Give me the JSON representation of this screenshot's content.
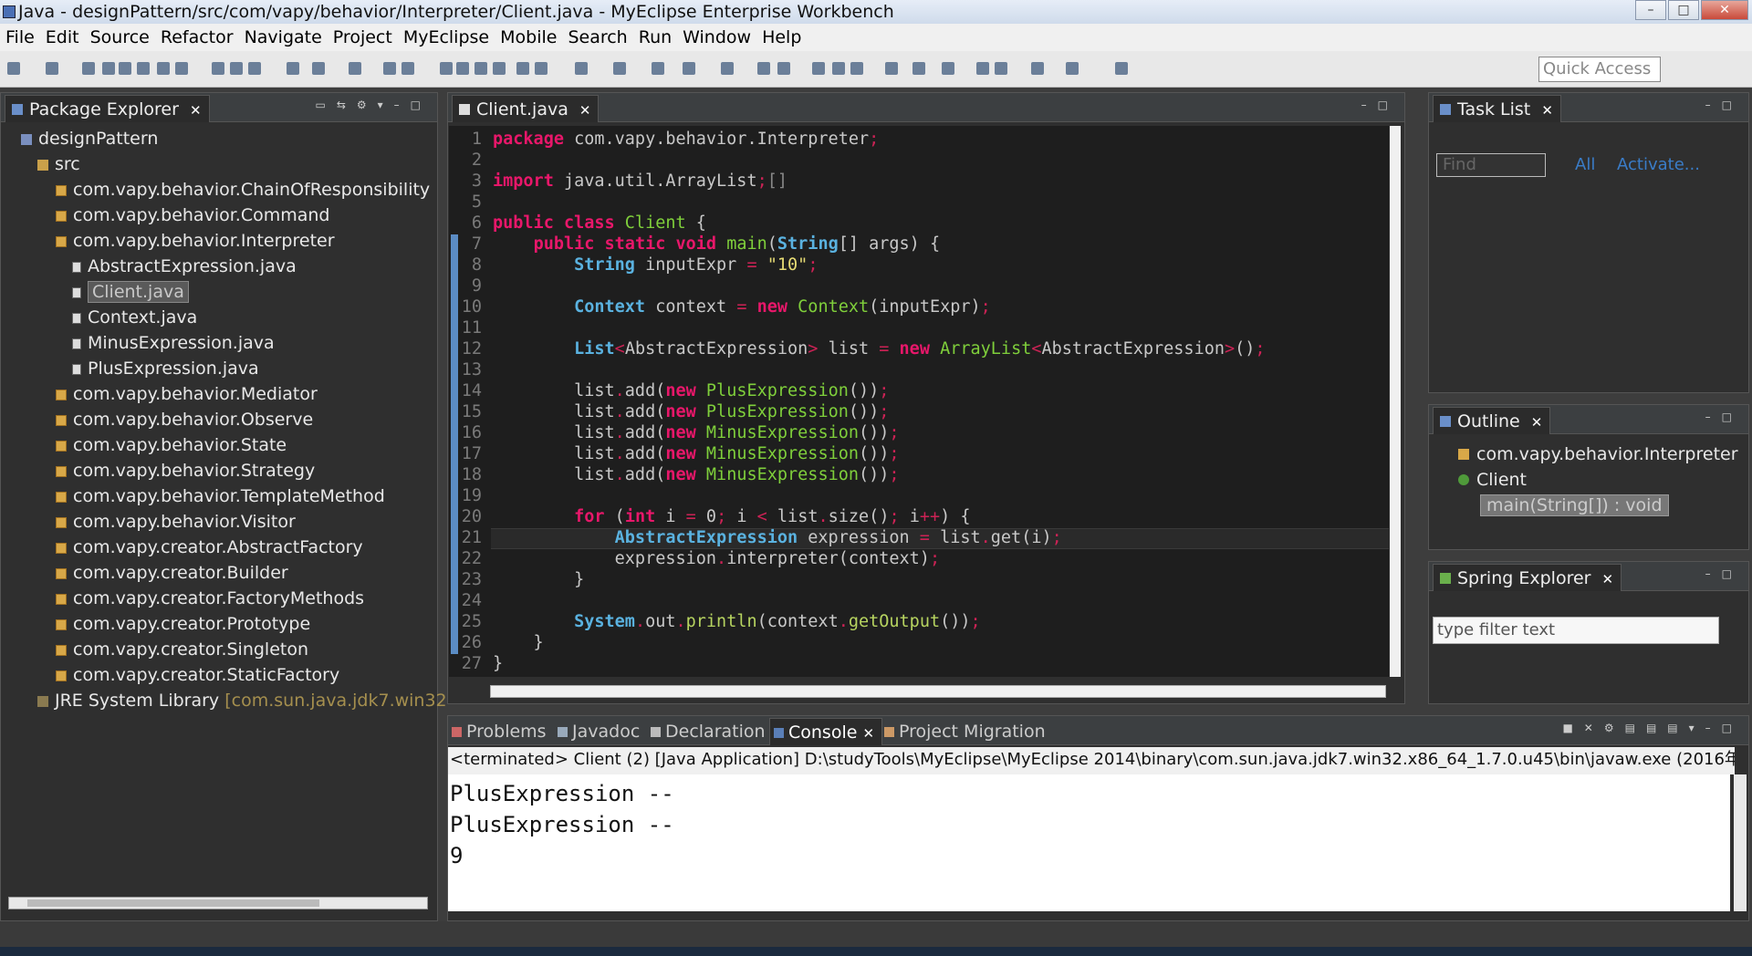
{
  "window": {
    "title": "Java - designPattern/src/com/vapy/behavior/Interpreter/Client.java - MyEclipse Enterprise Workbench"
  },
  "menu": [
    "File",
    "Edit",
    "Source",
    "Refactor",
    "Navigate",
    "Project",
    "MyEclipse",
    "Mobile",
    "Search",
    "Run",
    "Window",
    "Help"
  ],
  "toolbar": {
    "quick_access": "Quick Access"
  },
  "package_explorer": {
    "title": "Package Explorer",
    "tree": [
      {
        "label": "designPattern",
        "icon": "project-icon",
        "depth": 0
      },
      {
        "label": "src",
        "icon": "source-folder-icon",
        "depth": 1
      },
      {
        "label": "com.vapy.behavior.ChainOfResponsibility",
        "icon": "package-icon",
        "depth": 2
      },
      {
        "label": "com.vapy.behavior.Command",
        "icon": "package-icon",
        "depth": 2
      },
      {
        "label": "com.vapy.behavior.Interpreter",
        "icon": "package-icon",
        "depth": 2
      },
      {
        "label": "AbstractExpression.java",
        "icon": "java-file-icon",
        "depth": 3
      },
      {
        "label": "Client.java",
        "icon": "java-file-icon",
        "depth": 3,
        "selected": true
      },
      {
        "label": "Context.java",
        "icon": "java-file-icon",
        "depth": 3
      },
      {
        "label": "MinusExpression.java",
        "icon": "java-file-icon",
        "depth": 3
      },
      {
        "label": "PlusExpression.java",
        "icon": "java-file-icon",
        "depth": 3
      },
      {
        "label": "com.vapy.behavior.Mediator",
        "icon": "package-icon",
        "depth": 2
      },
      {
        "label": "com.vapy.behavior.Observe",
        "icon": "package-icon",
        "depth": 2
      },
      {
        "label": "com.vapy.behavior.State",
        "icon": "package-icon",
        "depth": 2
      },
      {
        "label": "com.vapy.behavior.Strategy",
        "icon": "package-icon",
        "depth": 2
      },
      {
        "label": "com.vapy.behavior.TemplateMethod",
        "icon": "package-icon",
        "depth": 2
      },
      {
        "label": "com.vapy.behavior.Visitor",
        "icon": "package-icon",
        "depth": 2
      },
      {
        "label": "com.vapy.creator.AbstractFactory",
        "icon": "package-icon",
        "depth": 2
      },
      {
        "label": "com.vapy.creator.Builder",
        "icon": "package-icon",
        "depth": 2
      },
      {
        "label": "com.vapy.creator.FactoryMethods",
        "icon": "package-icon",
        "depth": 2
      },
      {
        "label": "com.vapy.creator.Prototype",
        "icon": "package-icon",
        "depth": 2
      },
      {
        "label": "com.vapy.creator.Singleton",
        "icon": "package-icon",
        "depth": 2
      },
      {
        "label": "com.vapy.creator.StaticFactory",
        "icon": "package-icon",
        "depth": 2
      }
    ],
    "jre": {
      "label": "JRE System Library",
      "detail": "[com.sun.java.jdk7.win32"
    }
  },
  "editor": {
    "tab": "Client.java",
    "lines": [
      {
        "n": "1",
        "code": [
          [
            "kw",
            "package"
          ],
          [
            "va",
            " com.vapy.behavior.Interpreter"
          ],
          [
            "op",
            ";"
          ]
        ]
      },
      {
        "n": "2",
        "code": []
      },
      {
        "n": "3",
        "code": [
          [
            "kw",
            "import"
          ],
          [
            "va",
            " java.util.ArrayList"
          ],
          [
            "op",
            ";"
          ],
          [
            "gr",
            "[]"
          ]
        ]
      },
      {
        "n": "5",
        "code": []
      },
      {
        "n": "6",
        "code": [
          [
            "kw",
            "public class "
          ],
          [
            "cn",
            "Client"
          ],
          [
            "va",
            " {"
          ]
        ]
      },
      {
        "n": "7",
        "code": [
          [
            "va",
            "    "
          ],
          [
            "kw",
            "public static void "
          ],
          [
            "cn",
            "main"
          ],
          [
            "va",
            "("
          ],
          [
            "ty",
            "String"
          ],
          [
            "va",
            "[] args) {"
          ]
        ]
      },
      {
        "n": "8",
        "code": [
          [
            "va",
            "        "
          ],
          [
            "ty",
            "String"
          ],
          [
            "va",
            " inputExpr "
          ],
          [
            "op",
            "="
          ],
          [
            "st",
            " \"10\""
          ],
          [
            "op",
            ";"
          ]
        ]
      },
      {
        "n": "9",
        "code": []
      },
      {
        "n": "10",
        "code": [
          [
            "va",
            "        "
          ],
          [
            "ty",
            "Context"
          ],
          [
            "va",
            " context "
          ],
          [
            "op",
            "="
          ],
          [
            "kw",
            " new "
          ],
          [
            "cn",
            "Context"
          ],
          [
            "va",
            "(inputExpr)"
          ],
          [
            "op",
            ";"
          ]
        ]
      },
      {
        "n": "11",
        "code": []
      },
      {
        "n": "12",
        "code": [
          [
            "va",
            "        "
          ],
          [
            "ty",
            "List"
          ],
          [
            "op",
            "<"
          ],
          [
            "va",
            "AbstractExpression"
          ],
          [
            "op",
            ">"
          ],
          [
            "va",
            " list "
          ],
          [
            "op",
            "="
          ],
          [
            "kw",
            " new "
          ],
          [
            "cn",
            "ArrayList"
          ],
          [
            "op",
            "<"
          ],
          [
            "va",
            "AbstractExpression"
          ],
          [
            "op",
            ">"
          ],
          [
            "va",
            "()"
          ],
          [
            "op",
            ";"
          ]
        ]
      },
      {
        "n": "13",
        "code": []
      },
      {
        "n": "14",
        "code": [
          [
            "va",
            "        list"
          ],
          [
            "op",
            "."
          ],
          [
            "va",
            "add("
          ],
          [
            "kw",
            "new "
          ],
          [
            "cn",
            "PlusExpression"
          ],
          [
            "va",
            "())"
          ],
          [
            "op",
            ";"
          ]
        ]
      },
      {
        "n": "15",
        "code": [
          [
            "va",
            "        list"
          ],
          [
            "op",
            "."
          ],
          [
            "va",
            "add("
          ],
          [
            "kw",
            "new "
          ],
          [
            "cn",
            "PlusExpression"
          ],
          [
            "va",
            "())"
          ],
          [
            "op",
            ";"
          ]
        ]
      },
      {
        "n": "16",
        "code": [
          [
            "va",
            "        list"
          ],
          [
            "op",
            "."
          ],
          [
            "va",
            "add("
          ],
          [
            "kw",
            "new "
          ],
          [
            "cn",
            "MinusExpression"
          ],
          [
            "va",
            "())"
          ],
          [
            "op",
            ";"
          ]
        ]
      },
      {
        "n": "17",
        "code": [
          [
            "va",
            "        list"
          ],
          [
            "op",
            "."
          ],
          [
            "va",
            "add("
          ],
          [
            "kw",
            "new "
          ],
          [
            "cn",
            "MinusExpression"
          ],
          [
            "va",
            "())"
          ],
          [
            "op",
            ";"
          ]
        ]
      },
      {
        "n": "18",
        "code": [
          [
            "va",
            "        list"
          ],
          [
            "op",
            "."
          ],
          [
            "va",
            "add("
          ],
          [
            "kw",
            "new "
          ],
          [
            "cn",
            "MinusExpression"
          ],
          [
            "va",
            "())"
          ],
          [
            "op",
            ";"
          ]
        ]
      },
      {
        "n": "19",
        "code": []
      },
      {
        "n": "20",
        "code": [
          [
            "va",
            "        "
          ],
          [
            "kw",
            "for"
          ],
          [
            "va",
            " ("
          ],
          [
            "kw",
            "int"
          ],
          [
            "va",
            " i "
          ],
          [
            "op",
            "="
          ],
          [
            "va",
            " 0"
          ],
          [
            "op",
            ";"
          ],
          [
            "va",
            " i "
          ],
          [
            "op",
            "<"
          ],
          [
            "va",
            " list"
          ],
          [
            "op",
            "."
          ],
          [
            "va",
            "size()"
          ],
          [
            "op",
            ";"
          ],
          [
            "va",
            " i"
          ],
          [
            "op",
            "++"
          ],
          [
            "va",
            ") {"
          ]
        ]
      },
      {
        "n": "21",
        "code": [
          [
            "va",
            "            "
          ],
          [
            "ty",
            "AbstractExpression"
          ],
          [
            "va",
            " expression "
          ],
          [
            "op",
            "="
          ],
          [
            "va",
            " list"
          ],
          [
            "op",
            "."
          ],
          [
            "va",
            "get(i)"
          ],
          [
            "op",
            ";"
          ]
        ]
      },
      {
        "n": "22",
        "code": [
          [
            "va",
            "            expression"
          ],
          [
            "op",
            "."
          ],
          [
            "va",
            "interpreter(context)"
          ],
          [
            "op",
            ";"
          ]
        ]
      },
      {
        "n": "23",
        "code": [
          [
            "va",
            "        }"
          ]
        ]
      },
      {
        "n": "24",
        "code": []
      },
      {
        "n": "25",
        "code": [
          [
            "va",
            "        "
          ],
          [
            "ty",
            "System"
          ],
          [
            "op",
            "."
          ],
          [
            "va",
            "out"
          ],
          [
            "op",
            "."
          ],
          [
            "mt",
            "println"
          ],
          [
            "va",
            "(context"
          ],
          [
            "op",
            "."
          ],
          [
            "mt",
            "getOutput"
          ],
          [
            "va",
            "())"
          ],
          [
            "op",
            ";"
          ]
        ]
      },
      {
        "n": "26",
        "code": [
          [
            "va",
            "    }"
          ]
        ]
      },
      {
        "n": "27",
        "code": [
          [
            "va",
            "}"
          ]
        ]
      }
    ]
  },
  "task_list": {
    "title": "Task List",
    "find_placeholder": "Find",
    "all": "All",
    "activate": "Activate..."
  },
  "outline": {
    "title": "Outline",
    "items": [
      {
        "label": "com.vapy.behavior.Interpreter"
      },
      {
        "label": "Client"
      },
      {
        "label": "main(String[]) : void",
        "selected": true
      }
    ]
  },
  "spring_explorer": {
    "title": "Spring Explorer",
    "filter_placeholder": "type filter text"
  },
  "bottom_tabs": [
    "Problems",
    "Javadoc",
    "Declaration",
    "Console",
    "Project Migration"
  ],
  "console": {
    "status": "<terminated> Client (2) [Java Application] D:\\studyTools\\MyEclipse\\MyEclipse 2014\\binary\\com.sun.java.jdk7.win32.x86_64_1.7.0.u45\\bin\\javaw.exe (2016年",
    "output": [
      "PlusExpression --",
      "PlusExpression --",
      "9"
    ]
  }
}
